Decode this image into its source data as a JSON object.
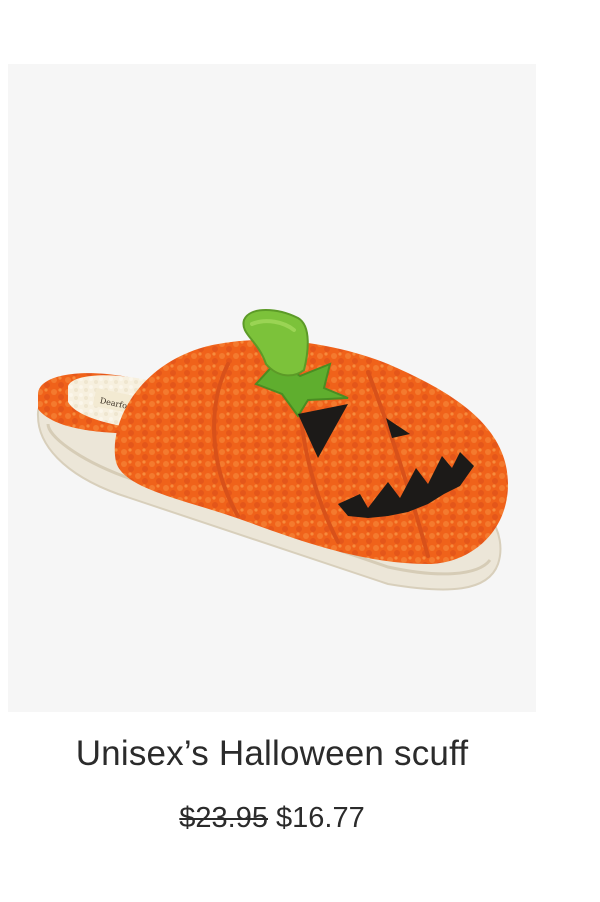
{
  "product": {
    "image_alt": "Orange pumpkin jack-o'-lantern fleece scuff slipper",
    "title": "Unisex’s Halloween scuff",
    "price_original": "$23.95",
    "price_sale": "$16.77",
    "colors": {
      "image_background": "#f6f6f6",
      "fleece_orange": "#f0621a",
      "stem_green": "#7cc23a",
      "sole_cream": "#ece6d8",
      "face_black": "#1c1a18",
      "text": "#2b2b2b"
    }
  }
}
